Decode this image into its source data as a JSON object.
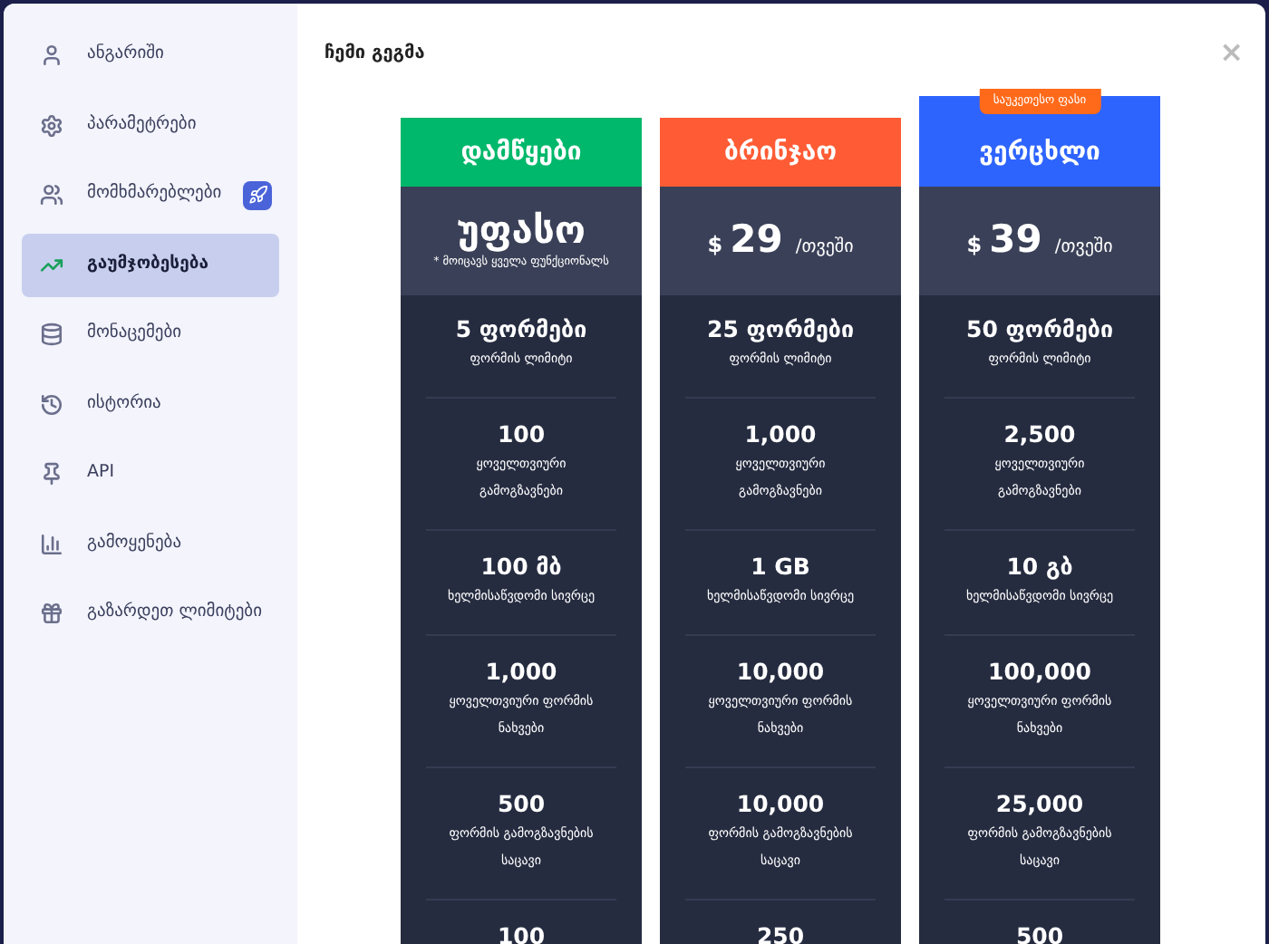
{
  "sidebar": {
    "items": [
      {
        "label": "ანგარიში",
        "selected": false
      },
      {
        "label": "პარამეტრები",
        "selected": false
      },
      {
        "label": "მომხმარებლები",
        "selected": false,
        "badge_icon": true
      },
      {
        "label": "გაუმჯობესება",
        "selected": true
      },
      {
        "label": "მონაცემები",
        "selected": false
      },
      {
        "label": "ისტორია",
        "selected": false
      },
      {
        "label": "API",
        "selected": false
      },
      {
        "label": "გამოყენება",
        "selected": false
      },
      {
        "label": "გაზარდეთ ლიმიტები",
        "selected": false
      }
    ]
  },
  "dialog": {
    "title": "ჩემი გეგმა",
    "close": "×"
  },
  "plans": [
    {
      "name": "დამწყები",
      "color": "#00b86b",
      "kind": "free",
      "price": "უფასო",
      "note": "* მოიცავს ყველა ფუნქციონალს",
      "features": [
        {
          "value": "5 ფორმები",
          "label": "ფორმის ლიმიტი"
        },
        {
          "value": "100",
          "label": "ყოველთვიური გამოგზავნები"
        },
        {
          "value": "100 მბ",
          "label": "ხელმისაწვდომი სივრცე"
        },
        {
          "value": "1,000",
          "label": "ყოველთვიური ფორმის ნახვები"
        },
        {
          "value": "500",
          "label": "ფორმის გამოგზავნების საცავი"
        },
        {
          "value": "100"
        }
      ]
    },
    {
      "name": "ბრინჯაო",
      "color": "#ff5c35",
      "kind": "paid",
      "currency": "$",
      "price": "29",
      "period": "/თვეში",
      "features": [
        {
          "value": "25 ფორმები",
          "label": "ფორმის ლიმიტი"
        },
        {
          "value": "1,000",
          "label": "ყოველთვიური გამოგზავნები"
        },
        {
          "value": "1 GB",
          "label": "ხელმისაწვდომი სივრცე"
        },
        {
          "value": "10,000",
          "label": "ყოველთვიური ფორმის ნახვები"
        },
        {
          "value": "10,000",
          "label": "ფორმის გამოგზავნების საცავი"
        },
        {
          "value": "250"
        }
      ]
    },
    {
      "name": "ვერცხლი",
      "color": "#2e64fe",
      "kind": "paid",
      "currency": "$",
      "price": "39",
      "period": "/თვეში",
      "ribbon": "საუკეთესო ფასი",
      "features": [
        {
          "value": "50 ფორმები",
          "label": "ფორმის ლიმიტი"
        },
        {
          "value": "2,500",
          "label": "ყოველთვიური გამოგზავნები"
        },
        {
          "value": "10 გბ",
          "label": "ხელმისაწვდომი სივრცე"
        },
        {
          "value": "100,000",
          "label": "ყოველთვიური ფორმის ნახვები"
        },
        {
          "value": "25,000",
          "label": "ფორმის გამოგზავნების საცავი"
        },
        {
          "value": "500"
        }
      ]
    }
  ]
}
